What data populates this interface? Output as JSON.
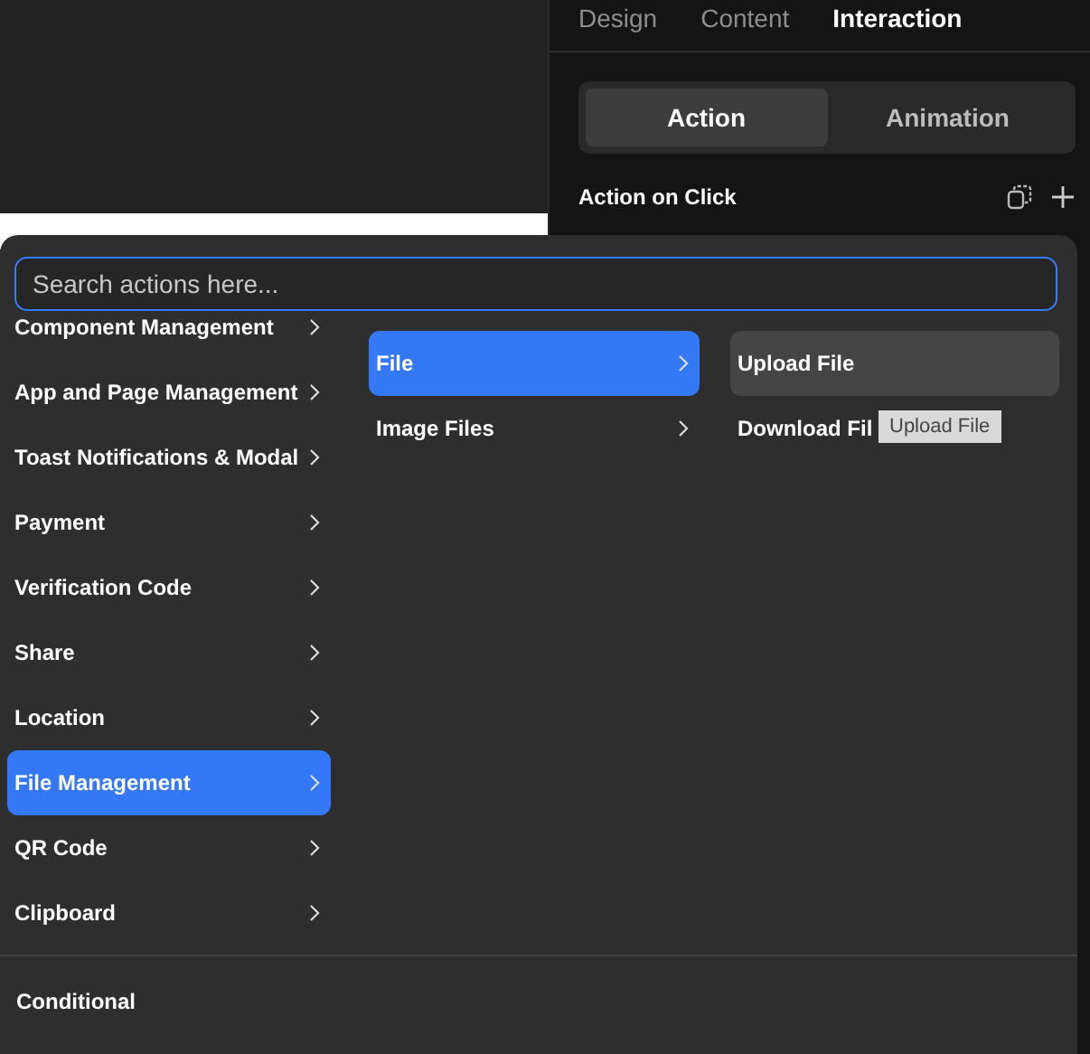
{
  "panel": {
    "tabs": [
      {
        "label": "Design",
        "selected": false
      },
      {
        "label": "Content",
        "selected": false
      },
      {
        "label": "Interaction",
        "selected": true
      }
    ],
    "segments": [
      {
        "label": "Action",
        "selected": true
      },
      {
        "label": "Animation",
        "selected": false
      }
    ],
    "section_title": "Action on Click"
  },
  "action_picker": {
    "search": {
      "placeholder": "Search actions here..."
    },
    "categories": [
      {
        "label": "Component Management",
        "selected": false
      },
      {
        "label": "App and Page Management",
        "selected": false
      },
      {
        "label": "Toast Notifications & Modal",
        "selected": false
      },
      {
        "label": "Payment",
        "selected": false
      },
      {
        "label": "Verification Code",
        "selected": false
      },
      {
        "label": "Share",
        "selected": false
      },
      {
        "label": "Location",
        "selected": false
      },
      {
        "label": "File Management",
        "selected": true
      },
      {
        "label": "QR Code",
        "selected": false
      },
      {
        "label": "Clipboard",
        "selected": false
      }
    ],
    "subcategories": [
      {
        "label": "File",
        "selected": true
      },
      {
        "label": "Image Files",
        "selected": false
      }
    ],
    "actions": [
      {
        "label": "Upload File",
        "selected": true
      },
      {
        "label": "Download Fil",
        "selected": false
      }
    ],
    "tooltip": "Upload File",
    "footer_item": "Conditional"
  }
}
